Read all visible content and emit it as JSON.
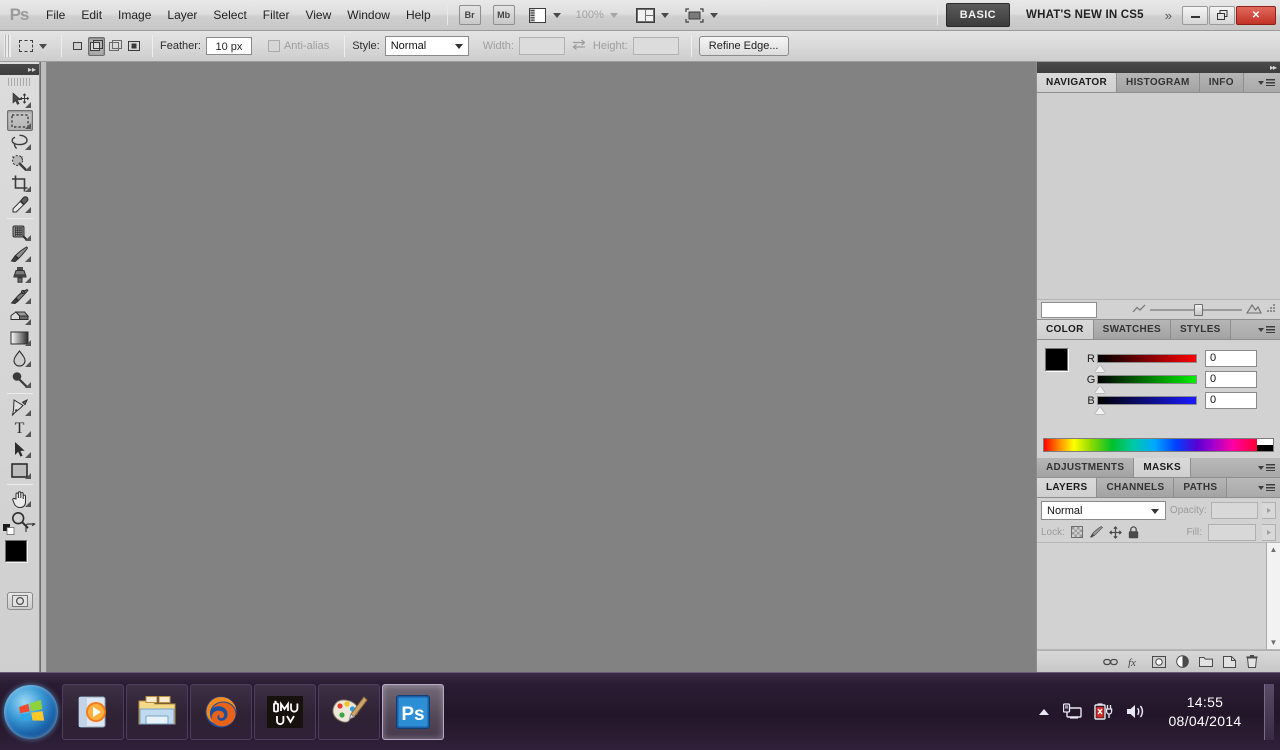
{
  "app": {
    "logo": "Ps",
    "menus": [
      "File",
      "Edit",
      "Image",
      "Layer",
      "Select",
      "Filter",
      "View",
      "Window",
      "Help"
    ],
    "quick_buttons": [
      {
        "name": "bridge-button",
        "label": "Br"
      },
      {
        "name": "mini-bridge-button",
        "label": "Mb"
      }
    ],
    "view_extras_icon": "view-extras-icon",
    "zoom_level": "100%",
    "arrange_documents_icon": "arrange-documents-icon",
    "screen_mode_icon": "screen-mode-icon",
    "workspace_basic": "BASIC",
    "whats_new": "WHAT'S NEW IN CS5",
    "more_chevron": "»",
    "window_controls": {
      "minimize": "–",
      "restore": "❐",
      "close": "✕"
    }
  },
  "options_bar": {
    "tool_preset_icon": "rectangular-marquee-icon",
    "selection_modes": [
      {
        "name": "new-selection-mode",
        "active": false
      },
      {
        "name": "add-to-selection-mode",
        "active": true
      },
      {
        "name": "subtract-from-selection-mode",
        "active": false
      },
      {
        "name": "intersect-selection-mode",
        "active": false
      }
    ],
    "feather_label": "Feather:",
    "feather_value": "10 px",
    "antialias_label": "Anti-alias",
    "style_label": "Style:",
    "style_value": "Normal",
    "width_label": "Width:",
    "width_value": "",
    "swap_icon": "swap-width-height-icon",
    "height_label": "Height:",
    "height_value": "",
    "refine_edge_label": "Refine Edge..."
  },
  "tools": [
    {
      "name": "move-tool",
      "label": "Move Tool",
      "active": false,
      "submenu": true
    },
    {
      "name": "rectangular-marquee-tool",
      "label": "Rectangular Marquee Tool",
      "active": true,
      "submenu": true
    },
    {
      "name": "lasso-tool",
      "label": "Lasso Tool",
      "active": false,
      "submenu": true
    },
    {
      "name": "quick-selection-tool",
      "label": "Quick Selection Tool",
      "active": false,
      "submenu": true
    },
    {
      "name": "crop-tool",
      "label": "Crop Tool",
      "active": false,
      "submenu": true
    },
    {
      "name": "eyedropper-tool",
      "label": "Eyedropper Tool",
      "active": false,
      "submenu": true
    },
    {
      "name": "spot-healing-brush-tool",
      "label": "Spot Healing Brush Tool",
      "active": false,
      "submenu": true
    },
    {
      "name": "brush-tool",
      "label": "Brush Tool",
      "active": false,
      "submenu": true
    },
    {
      "name": "clone-stamp-tool",
      "label": "Clone Stamp Tool",
      "active": false,
      "submenu": true
    },
    {
      "name": "history-brush-tool",
      "label": "History Brush Tool",
      "active": false,
      "submenu": true
    },
    {
      "name": "eraser-tool",
      "label": "Eraser Tool",
      "active": false,
      "submenu": true
    },
    {
      "name": "gradient-tool",
      "label": "Gradient Tool",
      "active": false,
      "submenu": true
    },
    {
      "name": "blur-tool",
      "label": "Blur Tool",
      "active": false,
      "submenu": true
    },
    {
      "name": "dodge-tool",
      "label": "Dodge Tool",
      "active": false,
      "submenu": true
    },
    {
      "name": "pen-tool",
      "label": "Pen Tool",
      "active": false,
      "submenu": true
    },
    {
      "name": "horizontal-type-tool",
      "label": "T",
      "active": false,
      "submenu": true
    },
    {
      "name": "path-selection-tool",
      "label": "Path Selection Tool",
      "active": false,
      "submenu": true
    },
    {
      "name": "rectangle-tool",
      "label": "Rectangle Tool",
      "active": false,
      "submenu": true
    },
    {
      "name": "hand-tool",
      "label": "Hand Tool",
      "active": false,
      "submenu": true
    },
    {
      "name": "zoom-tool",
      "label": "Zoom Tool",
      "active": false,
      "submenu": false
    }
  ],
  "tool_colors": {
    "foreground": "#000000",
    "background": "#ffffff",
    "default_colors_icon": "default-colors-icon",
    "swap_colors_icon": "swap-colors-icon",
    "quick_mask_icon": "quick-mask-icon"
  },
  "dock": {
    "navigator_group": {
      "tabs": [
        {
          "label": "NAVIGATOR",
          "active": true
        },
        {
          "label": "HISTOGRAM",
          "active": false
        },
        {
          "label": "INFO",
          "active": false
        }
      ],
      "zoom_field_value": "",
      "zoom_out_icon": "zoom-out-icon",
      "zoom_in_icon": "zoom-in-icon",
      "resize_grip_icon": "resize-grip-icon"
    },
    "color_group": {
      "tabs": [
        {
          "label": "COLOR",
          "active": true
        },
        {
          "label": "SWATCHES",
          "active": false
        },
        {
          "label": "STYLES",
          "active": false
        }
      ],
      "channels": [
        {
          "label": "R",
          "value": "0"
        },
        {
          "label": "G",
          "value": "0"
        },
        {
          "label": "B",
          "value": "0"
        }
      ],
      "ramp_white": "#ffffff",
      "ramp_black": "#000000"
    },
    "adjustments_group": {
      "tabs": [
        {
          "label": "ADJUSTMENTS",
          "active": false
        },
        {
          "label": "MASKS",
          "active": true
        }
      ]
    },
    "layers_group": {
      "tabs": [
        {
          "label": "LAYERS",
          "active": true
        },
        {
          "label": "CHANNELS",
          "active": false
        },
        {
          "label": "PATHS",
          "active": false
        }
      ],
      "blend_mode": "Normal",
      "opacity_label": "Opacity:",
      "opacity_value": "",
      "lock_label": "Lock:",
      "lock_icons": [
        "lock-transparent-pixels-icon",
        "lock-image-pixels-icon",
        "lock-position-icon",
        "lock-all-icon"
      ],
      "fill_label": "Fill:",
      "fill_value": "",
      "footer_icons": [
        "link-layers-icon",
        "layer-style-fx-icon",
        "add-layer-mask-icon",
        "new-adjustment-layer-icon",
        "new-group-icon",
        "new-layer-icon",
        "delete-layer-icon"
      ]
    }
  },
  "taskbar": {
    "start_label": "start-orb",
    "items": [
      {
        "name": "taskbar-item-windows-media-player",
        "label": "Windows Media Player",
        "active": false
      },
      {
        "name": "taskbar-item-windows-explorer",
        "label": "Windows Explorer",
        "active": false
      },
      {
        "name": "taskbar-item-firefox",
        "label": "Mozilla Firefox",
        "active": false
      },
      {
        "name": "taskbar-item-imvu",
        "label": "IMVU",
        "active": false
      },
      {
        "name": "taskbar-item-paint",
        "label": "Paint",
        "active": false
      },
      {
        "name": "taskbar-item-photoshop",
        "label": "Ps",
        "active": true
      }
    ],
    "tray": {
      "show_hidden_icons": "show-hidden-icons-icon",
      "network_icon": "network-icon",
      "battery_icon": "battery-error-icon",
      "volume_icon": "volume-icon"
    },
    "clock_time": "14:55",
    "clock_date": "08/04/2014"
  }
}
